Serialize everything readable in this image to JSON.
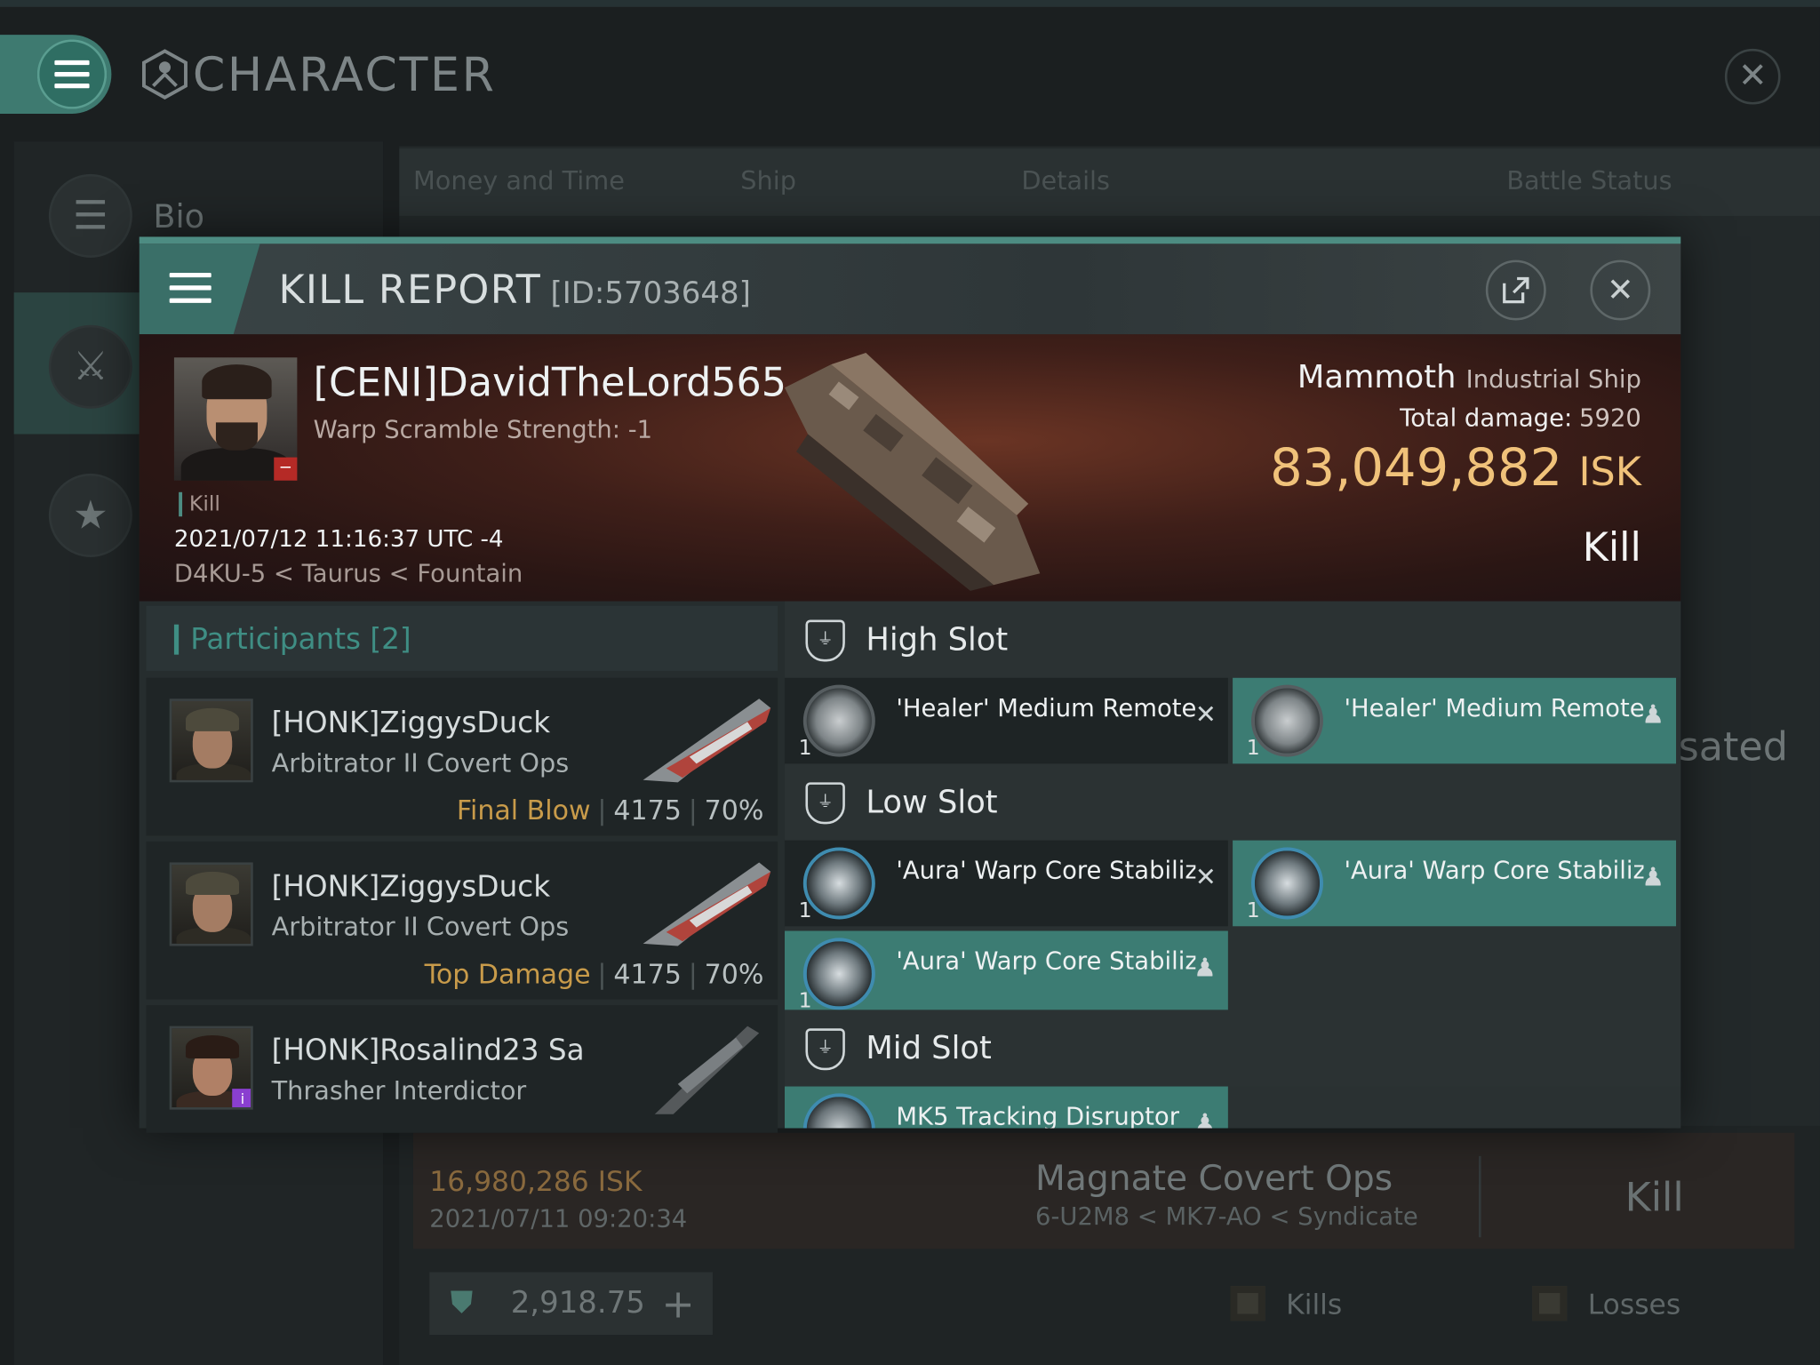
{
  "app": {
    "title": "CHARACTER"
  },
  "sidebar": {
    "items": [
      {
        "label": "Bio",
        "icon": "list-icon"
      },
      {
        "label": "",
        "icon": "crossed-swords-icon"
      },
      {
        "label": "",
        "icon": "star-icon"
      }
    ]
  },
  "background": {
    "tabs": [
      "Money and Time",
      "Ship",
      "Details",
      "Battle Status"
    ],
    "partial_text": "sated",
    "row": {
      "isk": "16,980,286 ISK",
      "date": "2021/07/11 09:20:34",
      "ship": "Magnate Covert Ops",
      "location": "6-U2M8 < MK7-AO < Syndicate",
      "type": "Kill"
    },
    "bar": {
      "value": "2,918.75",
      "plus": "+"
    },
    "legend": {
      "kills": "Kills",
      "losses": "Losses"
    }
  },
  "modal": {
    "title": "KILL REPORT",
    "id": "[ID:5703648]",
    "victim": {
      "name": "[CENI]DavidTheLord565",
      "scram": "Warp Scramble Strength: -1",
      "kill_tag": "Kill",
      "datetime": "2021/07/12 11:16:37 UTC -4",
      "location": "D4KU-5 < Taurus < Fountain",
      "ship_name": "Mammoth",
      "ship_class": "Industrial Ship",
      "damage_label": "Total damage:",
      "damage_value": "5920",
      "isk_value": "83,049,882",
      "isk_unit": "ISK",
      "type": "Kill"
    },
    "participants": {
      "title": "Participants",
      "count": "[2]",
      "rows": [
        {
          "name": "[HONK]ZiggysDuck",
          "ship": "Arbitrator II Covert Ops",
          "label": "Final Blow",
          "damage": "4175",
          "percent": "70%"
        },
        {
          "name": "[HONK]ZiggysDuck",
          "ship": "Arbitrator II Covert Ops",
          "label": "Top Damage",
          "damage": "4175",
          "percent": "70%"
        },
        {
          "name": "[HONK]Rosalind23 Sa",
          "ship": "Thrasher Interdictor",
          "label": "",
          "damage": "",
          "percent": ""
        }
      ]
    },
    "fitting": {
      "high": {
        "label": "High Slot",
        "mods": [
          {
            "name": "'Healer' Medium Remote...",
            "qty": "1",
            "status": "destroyed"
          },
          {
            "name": "'Healer' Medium Remote...",
            "qty": "1",
            "status": "dropped"
          }
        ]
      },
      "low": {
        "label": "Low Slot",
        "mods": [
          {
            "name": "'Aura' Warp Core Stabilizer",
            "qty": "1",
            "status": "destroyed"
          },
          {
            "name": "'Aura' Warp Core Stabilizer",
            "qty": "1",
            "status": "dropped"
          },
          {
            "name": "'Aura' Warp Core Stabilizer",
            "qty": "1",
            "status": "dropped"
          }
        ]
      },
      "mid": {
        "label": "Mid Slot",
        "mods": [
          {
            "name": "MK5 Tracking Disruptor",
            "qty": "",
            "status": "dropped"
          }
        ]
      }
    }
  },
  "colors": {
    "accent": "#3c7c73",
    "isk": "#f0c27a",
    "final_blow": "#c89b4a"
  }
}
